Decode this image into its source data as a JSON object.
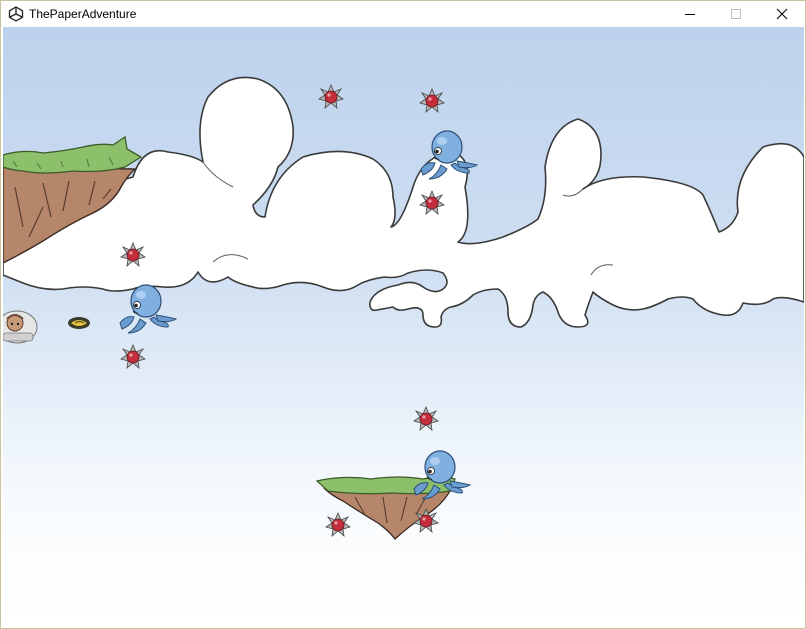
{
  "window": {
    "title": "ThePaperAdventure",
    "app_icon": "unity-icon",
    "controls": {
      "minimize": "minimize-icon",
      "maximize": "maximize-icon",
      "close": "close-icon"
    }
  },
  "game": {
    "sky_colors": {
      "top": "#bcd2ec",
      "bottom": "#ffffff"
    },
    "entities": {
      "player": "player-character",
      "projectile": "energy-shot",
      "enemies": "blue-octopus",
      "hazards": "red-spiked-mine",
      "platforms": "floating-grass-island"
    },
    "counts": {
      "octopus_enemies": 3,
      "spiked_mines": 8,
      "floating_islands": 2
    }
  }
}
